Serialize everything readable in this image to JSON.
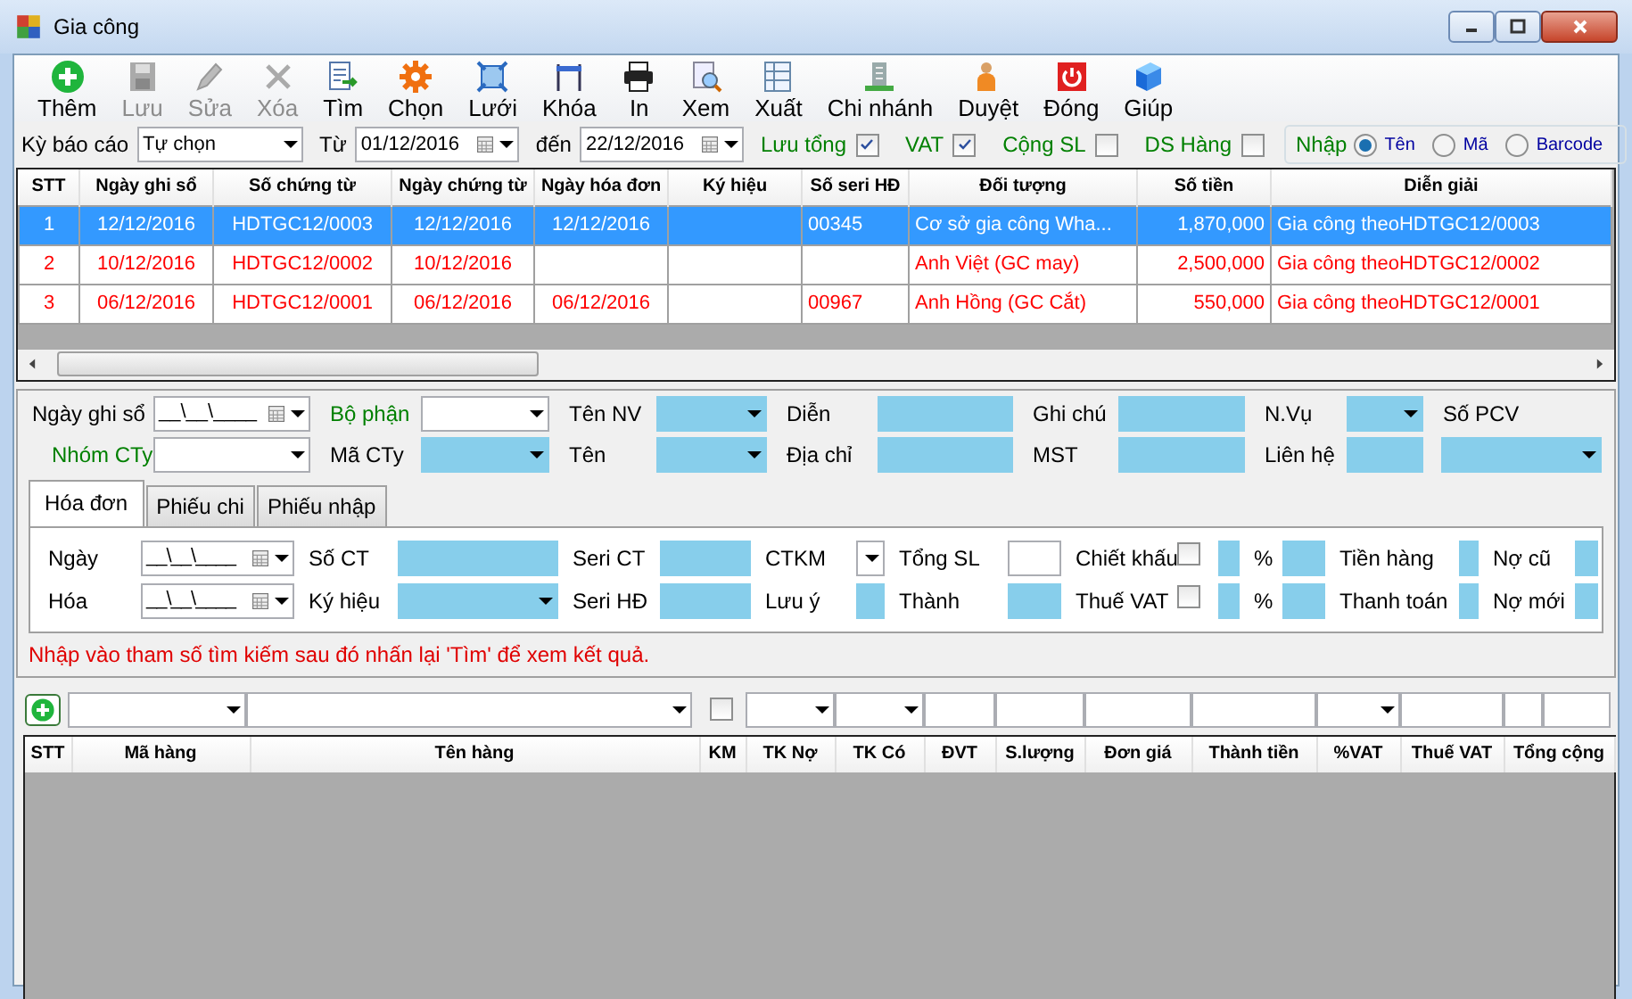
{
  "window": {
    "title": "Gia công"
  },
  "toolbar": [
    {
      "label": "Thêm",
      "disabled": false
    },
    {
      "label": "Lưu",
      "disabled": true
    },
    {
      "label": "Sửa",
      "disabled": true
    },
    {
      "label": "Xóa",
      "disabled": true
    },
    {
      "label": "Tìm",
      "disabled": false
    },
    {
      "label": "Chọn",
      "disabled": false
    },
    {
      "label": "Lưới",
      "disabled": false
    },
    {
      "label": "Khóa",
      "disabled": false
    },
    {
      "label": "In",
      "disabled": false
    },
    {
      "label": "Xem",
      "disabled": false
    },
    {
      "label": "Xuất",
      "disabled": false
    },
    {
      "label": "Chi nhánh",
      "disabled": false
    },
    {
      "label": "Duyệt",
      "disabled": false
    },
    {
      "label": "Đóng",
      "disabled": false
    },
    {
      "label": "Giúp",
      "disabled": false
    }
  ],
  "filter": {
    "period": {
      "label": "Kỳ báo cáo",
      "value": "Tự chọn"
    },
    "from": {
      "label": "Từ",
      "value": "01/12/2016"
    },
    "to": {
      "label": "đến",
      "value": "22/12/2016"
    },
    "checks": [
      {
        "label": "Lưu tổng",
        "checked": true
      },
      {
        "label": "VAT",
        "checked": true
      },
      {
        "label": "Cộng SL",
        "checked": false
      },
      {
        "label": "DS Hàng",
        "checked": false
      }
    ],
    "import_mode": {
      "label": "Nhập",
      "options": [
        {
          "label": "Tên",
          "selected": true
        },
        {
          "label": "Mã",
          "selected": false
        },
        {
          "label": "Barcode",
          "selected": false
        }
      ]
    }
  },
  "table": {
    "columns": [
      "STT",
      "Ngày ghi sổ",
      "Số chứng từ",
      "Ngày chứng từ",
      "Ngày hóa đơn",
      "Ký hiệu",
      "Số seri HĐ",
      "Đối tượng",
      "Số tiền",
      "Diễn giải"
    ],
    "rows": [
      {
        "selected": true,
        "cells": [
          "1",
          "12/12/2016",
          "HDTGC12/0003",
          "12/12/2016",
          "12/12/2016",
          null,
          "00345",
          "Cơ sở gia công Wha...",
          "1,870,000",
          "Gia công theoHDTGC12/0003"
        ]
      },
      {
        "selected": false,
        "cells": [
          "2",
          "10/12/2016",
          "HDTGC12/0002",
          "10/12/2016",
          null,
          null,
          null,
          "Anh Việt (GC may)",
          "2,500,000",
          "Gia công theoHDTGC12/0002"
        ]
      },
      {
        "selected": false,
        "cells": [
          "3",
          "06/12/2016",
          "HDTGC12/0001",
          "06/12/2016",
          "06/12/2016",
          null,
          "00967",
          "Anh Hồng (GC Cắt)",
          "550,000",
          "Gia công theoHDTGC12/0001"
        ]
      }
    ]
  },
  "form": {
    "rows": [
      [
        {
          "kind": "label",
          "text": "Ngày ghi sổ"
        },
        {
          "kind": "date",
          "value": "__\\__\\____"
        },
        {
          "kind": "label",
          "text": "Bộ phận",
          "color": "#008000"
        },
        {
          "kind": "combo",
          "shaded": false
        },
        {
          "kind": "label",
          "text": "Tên NV"
        },
        {
          "kind": "combo",
          "shaded": true
        },
        {
          "kind": "label",
          "text": "Diễn"
        },
        {
          "kind": "text",
          "shaded": true
        },
        {
          "kind": "label",
          "text": "Ghi chú"
        },
        {
          "kind": "text",
          "shaded": true
        },
        {
          "kind": "label",
          "text": "N.Vụ"
        },
        {
          "kind": "combo",
          "shaded": true
        },
        {
          "kind": "label",
          "text": "Số PCV"
        }
      ],
      [
        {
          "kind": "label",
          "text": "Nhóm CTy",
          "color": "#008000"
        },
        {
          "kind": "combo",
          "shaded": false
        },
        {
          "kind": "label",
          "text": "Mã CTy"
        },
        {
          "kind": "combo",
          "shaded": true
        },
        {
          "kind": "label",
          "text": "Tên"
        },
        {
          "kind": "combo",
          "shaded": true
        },
        {
          "kind": "label",
          "text": "Địa chỉ"
        },
        {
          "kind": "text",
          "shaded": true
        },
        {
          "kind": "label",
          "text": "MST"
        },
        {
          "kind": "text",
          "shaded": true
        },
        {
          "kind": "label",
          "text": "Liên hệ"
        },
        {
          "kind": "text",
          "shaded": true
        },
        {
          "kind": "combo",
          "shaded": true
        }
      ]
    ]
  },
  "tabs": [
    {
      "label": "Hóa đơn",
      "selected": true
    },
    {
      "label": "Phiếu chi",
      "selected": false
    },
    {
      "label": "Phiếu nhập",
      "selected": false
    }
  ],
  "tab_panel": {
    "rows": [
      [
        {
          "kind": "label",
          "text": "Ngày"
        },
        {
          "kind": "date",
          "value": "__\\__\\____"
        },
        {
          "kind": "label",
          "text": "Số CT"
        },
        {
          "kind": "text",
          "shaded": true
        },
        {
          "kind": "label",
          "text": "Seri CT"
        },
        {
          "kind": "text",
          "shaded": true
        },
        {
          "kind": "label",
          "text": "CTKM"
        },
        {
          "kind": "combo",
          "shaded": false
        },
        {
          "kind": "label",
          "text": "Tổng SL"
        },
        {
          "kind": "text",
          "shaded": false
        },
        {
          "kind": "label",
          "text": "Chiết khấu"
        },
        {
          "kind": "check",
          "checked": false
        },
        {
          "kind": "text",
          "shaded": true
        },
        {
          "kind": "label",
          "text": "%"
        },
        {
          "kind": "text",
          "shaded": true
        },
        {
          "kind": "label",
          "text": "Tiền hàng"
        },
        {
          "kind": "text",
          "shaded": true
        },
        {
          "kind": "label",
          "text": "Nợ cũ"
        },
        {
          "kind": "text",
          "shaded": true
        }
      ],
      [
        {
          "kind": "label",
          "text": "Hóa"
        },
        {
          "kind": "date",
          "value": "__\\__\\____"
        },
        {
          "kind": "label",
          "text": "Ký hiệu"
        },
        {
          "kind": "combo",
          "shaded": true
        },
        {
          "kind": "label",
          "text": "Seri HĐ"
        },
        {
          "kind": "text",
          "shaded": true
        },
        {
          "kind": "label",
          "text": "Lưu ý"
        },
        {
          "kind": "text",
          "shaded": true
        },
        {
          "kind": "label",
          "text": "Thành"
        },
        {
          "kind": "text",
          "shaded": true
        },
        {
          "kind": "label",
          "text": "Thuế VAT"
        },
        {
          "kind": "check",
          "checked": false
        },
        {
          "kind": "text",
          "shaded": true
        },
        {
          "kind": "label",
          "text": "%"
        },
        {
          "kind": "text",
          "shaded": true
        },
        {
          "kind": "label",
          "text": "Thanh toán"
        },
        {
          "kind": "text",
          "shaded": true
        },
        {
          "kind": "label",
          "text": "Nợ mới"
        },
        {
          "kind": "text",
          "shaded": true
        }
      ]
    ]
  },
  "hint": "Nhập vào tham số tìm kiếm sau đó nhấn lại 'Tìm' để xem kết quả.",
  "entry_row": [
    {
      "kind": "add"
    },
    {
      "kind": "combo"
    },
    {
      "kind": "combo"
    },
    {
      "kind": "check",
      "checked": false
    },
    {
      "kind": "combo"
    },
    {
      "kind": "combo"
    },
    {
      "kind": "text"
    },
    {
      "kind": "text"
    },
    {
      "kind": "text"
    },
    {
      "kind": "text"
    },
    {
      "kind": "combo"
    },
    {
      "kind": "text"
    },
    {
      "kind": "text"
    },
    {
      "kind": "text"
    }
  ],
  "details": {
    "columns": [
      "STT",
      "Mã hàng",
      "Tên hàng",
      "KM",
      "TK Nợ",
      "TK Có",
      "ĐVT",
      "S.lượng",
      "Đơn giá",
      "Thành tiền",
      "%VAT",
      "Thuế VAT",
      "Tổng cộng"
    ]
  }
}
